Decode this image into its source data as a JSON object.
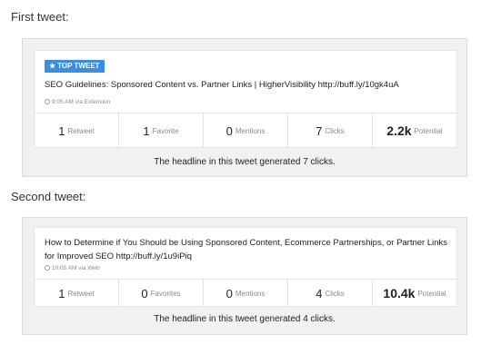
{
  "tweets": [
    {
      "section_label": "First tweet:",
      "badge": "TOP TWEET",
      "text": "SEO Guidelines: Sponsored Content vs. Partner Links | HigherVisibility http://buff.ly/10gk4uA",
      "meta": "9:05 AM via Extension",
      "stats": [
        {
          "value": "1",
          "label": "Retweet"
        },
        {
          "value": "1",
          "label": "Favorite"
        },
        {
          "value": "0",
          "label": "Mentions"
        },
        {
          "value": "7",
          "label": "Clicks"
        },
        {
          "value": "2.2k",
          "label": "Potential"
        }
      ],
      "caption": "The headline in this tweet generated 7 clicks."
    },
    {
      "section_label": "Second tweet:",
      "text": "How to Determine if You Should be Using Sponsored Content, Ecommerce Partnerships, or Partner Links for Improved SEO http://buff.ly/1u9iPiq",
      "meta": "10:05 AM via Web",
      "stats": [
        {
          "value": "1",
          "label": "Retweet"
        },
        {
          "value": "0",
          "label": "Favorites"
        },
        {
          "value": "0",
          "label": "Mentions"
        },
        {
          "value": "4",
          "label": "Clicks"
        },
        {
          "value": "10.4k",
          "label": "Potential"
        }
      ],
      "caption": "The headline in this tweet generated 4 clicks."
    }
  ],
  "icons": {
    "badge_icon": "star-icon",
    "meta_icon": "clock-icon"
  },
  "colors": {
    "badge_bg": "#3b8de0",
    "figure_bg": "#f1f1f1"
  }
}
